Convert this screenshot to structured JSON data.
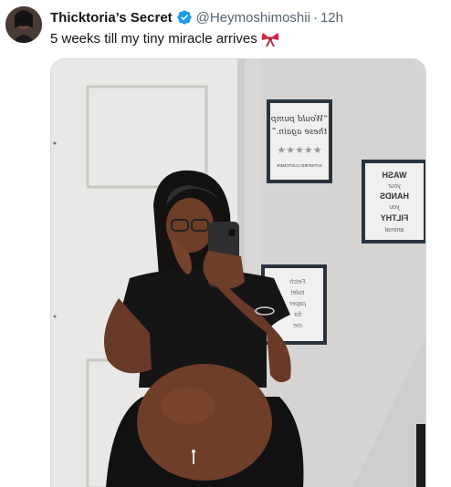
{
  "tweet": {
    "display_name": "Thicktoria’s Secret",
    "handle": "@Heymoshimoshii",
    "separator": "·",
    "timestamp": "12h",
    "text": "5 weeks till my tiny miracle arrives",
    "emoji": "ribbon",
    "verified": true
  },
  "media": {
    "frame_1": {
      "lines": [
        "“Would pump",
        "these again.”",
        "★★★★★",
        "SATISFIED CUSTOMER"
      ]
    },
    "frame_2": {
      "lines": [
        "WASH",
        "your",
        "HANDS",
        "you",
        "FILTHY",
        "animal"
      ]
    },
    "frame_3": {
      "lines": [
        "Fetch",
        "toilet",
        "paper",
        "for",
        "me"
      ]
    }
  },
  "colors": {
    "accent": "#1d9bf0",
    "bow": "#d8264a",
    "text": "#0f1419",
    "muted": "#536471"
  }
}
